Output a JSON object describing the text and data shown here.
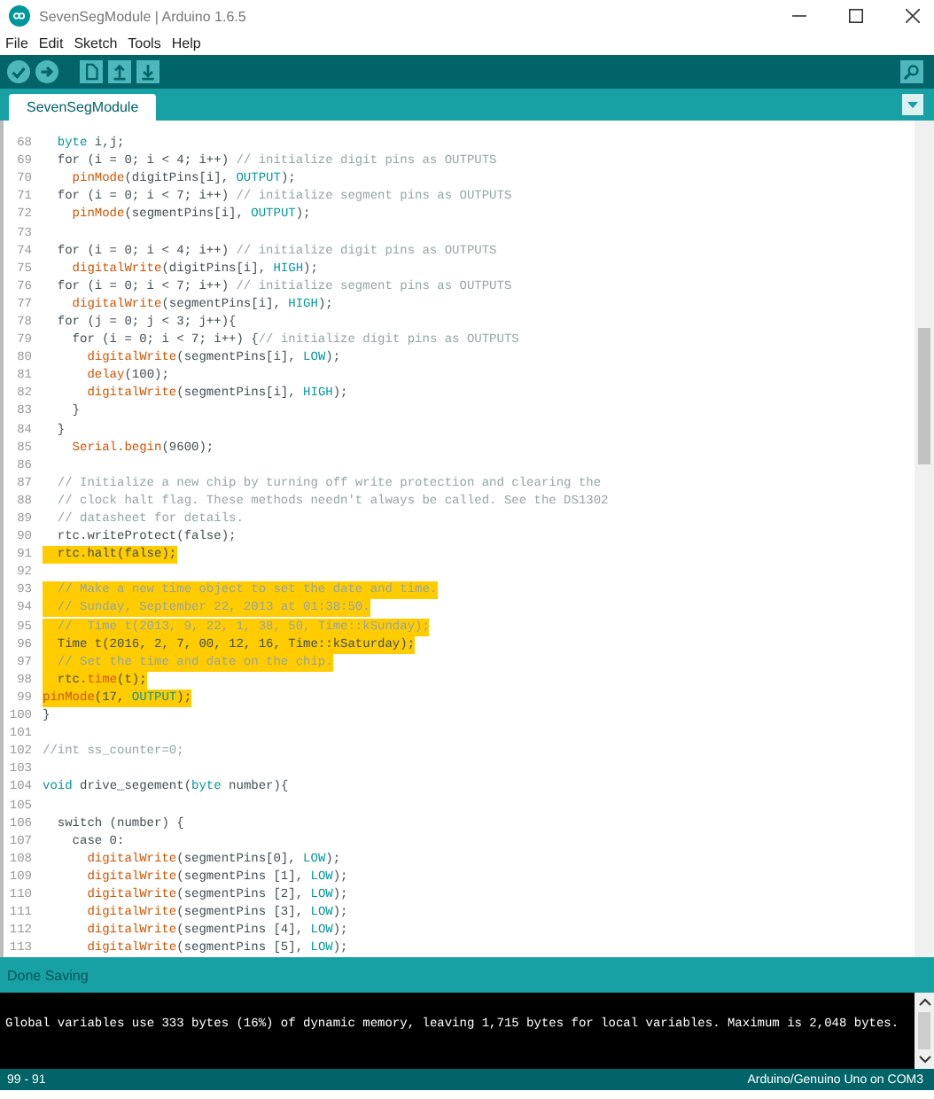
{
  "window": {
    "title": "SevenSegModule | Arduino 1.6.5"
  },
  "menu": [
    "File",
    "Edit",
    "Sketch",
    "Tools",
    "Help"
  ],
  "tabs": [
    {
      "label": "SevenSegModule",
      "selected": true
    }
  ],
  "editor": {
    "lines": [
      {
        "number": "68",
        "selected": false,
        "segments": [
          {
            "kind": "type",
            "text": "  byte"
          },
          {
            "kind": "plain",
            "text": " i,j;"
          }
        ]
      },
      {
        "number": "69",
        "selected": false,
        "segments": [
          {
            "kind": "plain",
            "text": "  for (i = 0; i < 4; i++) "
          },
          {
            "kind": "comment",
            "text": "// initialize digit pins as OUTPUTS"
          }
        ]
      },
      {
        "number": "70",
        "selected": false,
        "segments": [
          {
            "kind": "func",
            "text": "    pinMode"
          },
          {
            "kind": "plain",
            "text": "(digitPins[i], "
          },
          {
            "kind": "const",
            "text": "OUTPUT"
          },
          {
            "kind": "plain",
            "text": ");"
          }
        ]
      },
      {
        "number": "71",
        "selected": false,
        "segments": [
          {
            "kind": "plain",
            "text": "  for (i = 0; i < 7; i++) "
          },
          {
            "kind": "comment",
            "text": "// initialize segment pins as OUTPUTS"
          }
        ]
      },
      {
        "number": "72",
        "selected": false,
        "segments": [
          {
            "kind": "func",
            "text": "    pinMode"
          },
          {
            "kind": "plain",
            "text": "(segmentPins[i], "
          },
          {
            "kind": "const",
            "text": "OUTPUT"
          },
          {
            "kind": "plain",
            "text": ");"
          }
        ]
      },
      {
        "number": "73",
        "selected": false
      },
      {
        "number": "74",
        "selected": false,
        "segments": [
          {
            "kind": "plain",
            "text": "  for (i = 0; i < 4; i++) "
          },
          {
            "kind": "comment",
            "text": "// initialize digit pins as OUTPUTS"
          }
        ]
      },
      {
        "number": "75",
        "selected": false,
        "segments": [
          {
            "kind": "func",
            "text": "    digitalWrite"
          },
          {
            "kind": "plain",
            "text": "(digitPins[i], "
          },
          {
            "kind": "const",
            "text": "HIGH"
          },
          {
            "kind": "plain",
            "text": ");"
          }
        ]
      },
      {
        "number": "76",
        "selected": false,
        "segments": [
          {
            "kind": "plain",
            "text": "  for (i = 0; i < 7; i++) "
          },
          {
            "kind": "comment",
            "text": "// initialize segment pins as OUTPUTS"
          }
        ]
      },
      {
        "number": "77",
        "selected": false,
        "segments": [
          {
            "kind": "func",
            "text": "    digitalWrite"
          },
          {
            "kind": "plain",
            "text": "(segmentPins[i], "
          },
          {
            "kind": "const",
            "text": "HIGH"
          },
          {
            "kind": "plain",
            "text": ");"
          }
        ]
      },
      {
        "number": "78",
        "selected": false,
        "segments": [
          {
            "kind": "plain",
            "text": "  for (j = 0; j < 3; j++){"
          }
        ]
      },
      {
        "number": "79",
        "selected": false,
        "segments": [
          {
            "kind": "plain",
            "text": "    for (i = 0; i < 7; i++) {"
          },
          {
            "kind": "comment",
            "text": "// initialize digit pins as OUTPUTS"
          }
        ]
      },
      {
        "number": "80",
        "selected": false,
        "segments": [
          {
            "kind": "func",
            "text": "      digitalWrite"
          },
          {
            "kind": "plain",
            "text": "(segmentPins[i], "
          },
          {
            "kind": "const",
            "text": "LOW"
          },
          {
            "kind": "plain",
            "text": ");"
          }
        ]
      },
      {
        "number": "81",
        "selected": false,
        "segments": [
          {
            "kind": "func",
            "text": "      delay"
          },
          {
            "kind": "plain",
            "text": "(100);"
          }
        ]
      },
      {
        "number": "82",
        "selected": false,
        "segments": [
          {
            "kind": "func",
            "text": "      digitalWrite"
          },
          {
            "kind": "plain",
            "text": "(segmentPins[i], "
          },
          {
            "kind": "const",
            "text": "HIGH"
          },
          {
            "kind": "plain",
            "text": ");"
          }
        ]
      },
      {
        "number": "83",
        "selected": false,
        "segments": [
          {
            "kind": "plain",
            "text": "    }"
          }
        ]
      },
      {
        "number": "84",
        "selected": false,
        "segments": [
          {
            "kind": "plain",
            "text": "  }"
          }
        ]
      },
      {
        "number": "85",
        "selected": false,
        "segments": [
          {
            "kind": "func",
            "text": "    Serial.begin"
          },
          {
            "kind": "plain",
            "text": "(9600);"
          }
        ]
      },
      {
        "number": "86",
        "selected": false
      },
      {
        "number": "87",
        "selected": false,
        "segments": [
          {
            "kind": "comment",
            "text": "  // Initialize a new chip by turning off write protection and clearing the"
          }
        ]
      },
      {
        "number": "88",
        "selected": false,
        "segments": [
          {
            "kind": "comment",
            "text": "  // clock halt flag. These methods needn't always be called. See the DS1302"
          }
        ]
      },
      {
        "number": "89",
        "selected": false,
        "segments": [
          {
            "kind": "comment",
            "text": "  // datasheet for details."
          }
        ]
      },
      {
        "number": "90",
        "selected": false,
        "segments": [
          {
            "kind": "plain",
            "text": "  rtc.writeProtect(false);"
          }
        ]
      },
      {
        "number": "91",
        "selected": true,
        "segments": [
          {
            "kind": "plain",
            "text": "  rtc.halt(false);"
          }
        ]
      },
      {
        "number": "92",
        "selected": false
      },
      {
        "number": "93",
        "selected": true,
        "segments": [
          {
            "kind": "comment",
            "text": "  // Make a new time object to set the date and time."
          }
        ]
      },
      {
        "number": "94",
        "selected": true,
        "segments": [
          {
            "kind": "comment",
            "text": "  // Sunday, September 22, 2013 at 01:38:50."
          }
        ]
      },
      {
        "number": "95",
        "selected": true,
        "segments": [
          {
            "kind": "comment",
            "text": "  //  Time t(2013, 9, 22, 1, 38, 50, Time::kSunday);"
          }
        ]
      },
      {
        "number": "96",
        "selected": true,
        "segments": [
          {
            "kind": "plain",
            "text": "  Time t(2016, 2, 7, 00, 12, 16, Time::kSaturday);"
          }
        ]
      },
      {
        "number": "97",
        "selected": true,
        "segments": [
          {
            "kind": "comment",
            "text": "  // Set the time and date on the chip."
          }
        ]
      },
      {
        "number": "98",
        "selected": true,
        "segments": [
          {
            "kind": "plain",
            "text": "  rtc."
          },
          {
            "kind": "func",
            "text": "time"
          },
          {
            "kind": "plain",
            "text": "(t);"
          }
        ]
      },
      {
        "number": "99",
        "selected": true,
        "segments": [
          {
            "kind": "func",
            "text": "pinMode"
          },
          {
            "kind": "plain",
            "text": "(17, "
          },
          {
            "kind": "const",
            "text": "OUTPUT"
          },
          {
            "kind": "plain",
            "text": ");"
          }
        ]
      },
      {
        "number": "100",
        "selected": false,
        "segments": [
          {
            "kind": "plain",
            "text": "}"
          }
        ]
      },
      {
        "number": "101",
        "selected": false
      },
      {
        "number": "102",
        "selected": false,
        "segments": [
          {
            "kind": "comment",
            "text": "//int ss_counter=0;"
          }
        ]
      },
      {
        "number": "103",
        "selected": false
      },
      {
        "number": "104",
        "selected": false,
        "segments": [
          {
            "kind": "type",
            "text": "void"
          },
          {
            "kind": "plain",
            "text": " drive_segement("
          },
          {
            "kind": "type",
            "text": "byte"
          },
          {
            "kind": "plain",
            "text": " number){"
          }
        ]
      },
      {
        "number": "105",
        "selected": false
      },
      {
        "number": "106",
        "selected": false,
        "segments": [
          {
            "kind": "plain",
            "text": "  switch (number) {"
          }
        ]
      },
      {
        "number": "107",
        "selected": false,
        "segments": [
          {
            "kind": "plain",
            "text": "    case 0:"
          }
        ]
      },
      {
        "number": "108",
        "selected": false,
        "segments": [
          {
            "kind": "func",
            "text": "      digitalWrite"
          },
          {
            "kind": "plain",
            "text": "(segmentPins[0], "
          },
          {
            "kind": "const",
            "text": "LOW"
          },
          {
            "kind": "plain",
            "text": ");"
          }
        ]
      },
      {
        "number": "109",
        "selected": false,
        "segments": [
          {
            "kind": "func",
            "text": "      digitalWrite"
          },
          {
            "kind": "plain",
            "text": "(segmentPins [1], "
          },
          {
            "kind": "const",
            "text": "LOW"
          },
          {
            "kind": "plain",
            "text": ");"
          }
        ]
      },
      {
        "number": "110",
        "selected": false,
        "segments": [
          {
            "kind": "func",
            "text": "      digitalWrite"
          },
          {
            "kind": "plain",
            "text": "(segmentPins [2], "
          },
          {
            "kind": "const",
            "text": "LOW"
          },
          {
            "kind": "plain",
            "text": ");"
          }
        ]
      },
      {
        "number": "111",
        "selected": false,
        "segments": [
          {
            "kind": "func",
            "text": "      digitalWrite"
          },
          {
            "kind": "plain",
            "text": "(segmentPins [3], "
          },
          {
            "kind": "const",
            "text": "LOW"
          },
          {
            "kind": "plain",
            "text": ");"
          }
        ]
      },
      {
        "number": "112",
        "selected": false,
        "segments": [
          {
            "kind": "func",
            "text": "      digitalWrite"
          },
          {
            "kind": "plain",
            "text": "(segmentPins [4], "
          },
          {
            "kind": "const",
            "text": "LOW"
          },
          {
            "kind": "plain",
            "text": ");"
          }
        ]
      },
      {
        "number": "113",
        "selected": false,
        "segments": [
          {
            "kind": "func",
            "text": "      digitalWrite"
          },
          {
            "kind": "plain",
            "text": "(segmentPins [5], "
          },
          {
            "kind": "const",
            "text": "LOW"
          },
          {
            "kind": "plain",
            "text": ");"
          }
        ]
      }
    ]
  },
  "message": "Done Saving",
  "console": {
    "lines": [
      "Global variables use 333 bytes (16%) of dynamic memory, leaving 1,715 bytes for local variables. Maximum is 2,048 bytes."
    ]
  },
  "status_bar": {
    "position": "99 - 91",
    "board": "Arduino/Genuino Uno on COM3"
  }
}
